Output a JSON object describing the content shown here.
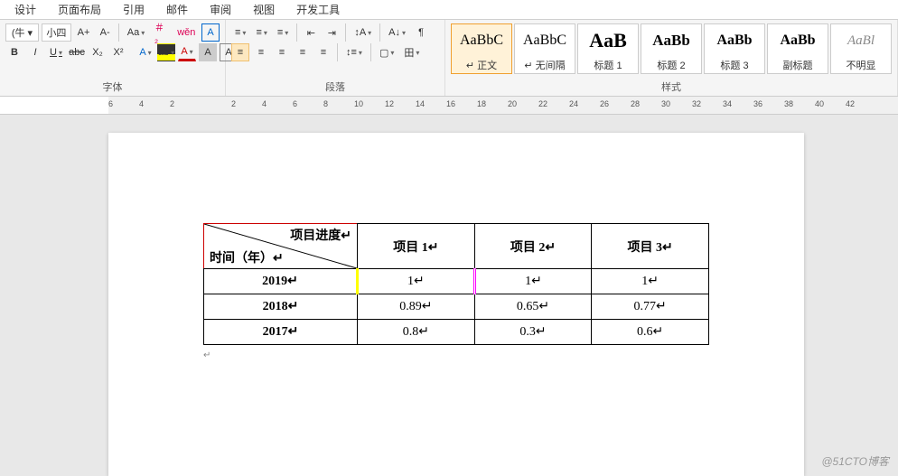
{
  "menu": {
    "items": [
      "设计",
      "页面布局",
      "引用",
      "邮件",
      "审阅",
      "视图",
      "开发工具"
    ]
  },
  "ribbon": {
    "font": {
      "fontbox": "(牛 ▾",
      "sizebox": "小四",
      "buttons_row1": [
        "A+",
        "A-",
        "Aa",
        "＃₂",
        "wěn",
        "A"
      ],
      "buttons_row2": [
        "B",
        "I",
        "U",
        "abc",
        "X₂",
        "X²",
        "A",
        "ab",
        "A",
        "A",
        "A"
      ],
      "label": "字体"
    },
    "paragraph": {
      "label": "段落"
    },
    "styles": {
      "items": [
        {
          "preview": "AaBbC",
          "name": "↵ 正文",
          "cls": "preview-normal",
          "selected": true
        },
        {
          "preview": "AaBbC",
          "name": "↵ 无间隔",
          "cls": "preview-normal",
          "selected": false
        },
        {
          "preview": "AaB",
          "name": "标题 1",
          "cls": "preview-h1",
          "selected": false
        },
        {
          "preview": "AaBb",
          "name": "标题 2",
          "cls": "preview-h2",
          "selected": false
        },
        {
          "preview": "AaBb",
          "name": "标题 3",
          "cls": "preview-h3",
          "selected": false
        },
        {
          "preview": "AaBb",
          "name": "副标题",
          "cls": "preview-sub",
          "selected": false
        },
        {
          "preview": "AaBl",
          "name": "不明显",
          "cls": "preview-dim",
          "selected": false
        }
      ],
      "label": "样式"
    }
  },
  "ruler": {
    "ticks": [
      "6",
      "4",
      "2",
      "",
      "2",
      "4",
      "6",
      "8",
      "10",
      "12",
      "14",
      "16",
      "18",
      "20",
      "22",
      "24",
      "26",
      "28",
      "30",
      "32",
      "34",
      "36",
      "38",
      "40",
      "42"
    ]
  },
  "document": {
    "table": {
      "corner_top": "项目进度",
      "corner_bottom": "时间（年）",
      "headers": [
        "项目 1",
        "项目 2",
        "项目 3"
      ],
      "rows": [
        {
          "year": "2019",
          "values": [
            "1",
            "1",
            "1"
          ]
        },
        {
          "year": "2018",
          "values": [
            "0.89",
            "0.65",
            "0.77"
          ]
        },
        {
          "year": "2017",
          "values": [
            "0.8",
            "0.3",
            "0.6"
          ]
        }
      ]
    }
  },
  "watermark": "@51CTO博客"
}
